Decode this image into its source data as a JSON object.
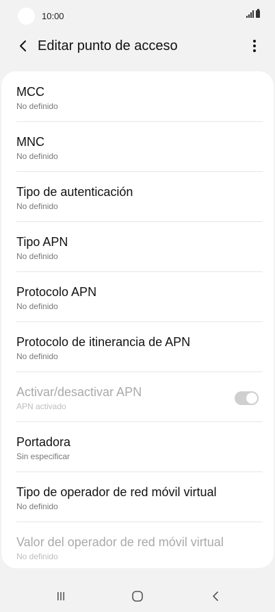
{
  "status_bar": {
    "time": "10:00"
  },
  "header": {
    "title": "Editar punto de acceso"
  },
  "settings": [
    {
      "title": "MCC",
      "subtitle": "No definido"
    },
    {
      "title": "MNC",
      "subtitle": "No definido"
    },
    {
      "title": "Tipo de autenticación",
      "subtitle": "No definido"
    },
    {
      "title": "Tipo APN",
      "subtitle": "No definido"
    },
    {
      "title": "Protocolo APN",
      "subtitle": "No definido"
    },
    {
      "title": "Protocolo de itinerancia de APN",
      "subtitle": "No definido"
    },
    {
      "title": "Activar/desactivar APN",
      "subtitle": "APN activado",
      "disabled": true,
      "toggle_on": true
    },
    {
      "title": "Portadora",
      "subtitle": "Sin especificar"
    },
    {
      "title": "Tipo de operador de red móvil virtual",
      "subtitle": "No definido"
    },
    {
      "title": "Valor del operador de red móvil virtual",
      "subtitle": "No definido",
      "disabled": true
    }
  ],
  "nav": {
    "recents_icon": "recents-icon",
    "home_icon": "home-icon",
    "back_icon": "back-icon"
  }
}
